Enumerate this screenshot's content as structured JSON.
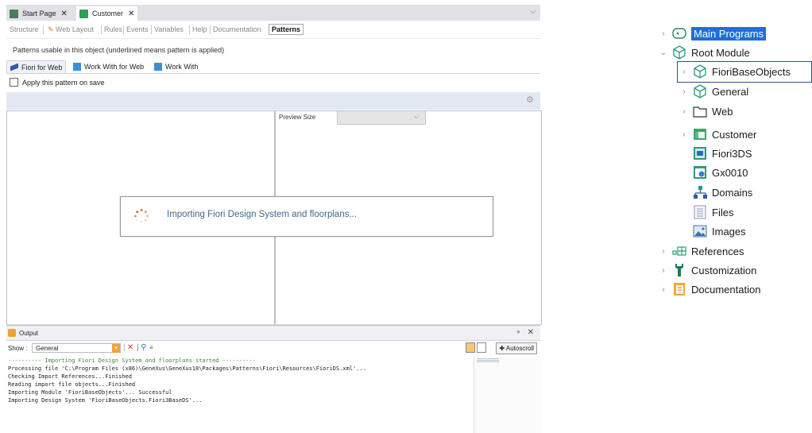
{
  "doc_tabs": [
    {
      "label": "Start Page",
      "close": "✕"
    },
    {
      "label": "Customer",
      "close": "✕"
    }
  ],
  "sub_tabs": [
    "Structure",
    "Web Layout",
    "Rules",
    "Events",
    "Variables",
    "Help",
    "Documentation",
    "Patterns"
  ],
  "info_text": "Patterns usable in this object (underlined means pattern is applied)",
  "pattern_tabs": [
    "Fiori for Web",
    "Work With for Web",
    "Work With"
  ],
  "apply_label": "Apply this pattern on save",
  "preview": {
    "label": "Preview Size",
    "value": ""
  },
  "popup_message": "Importing Fiori Design System and floorplans...",
  "output": {
    "title": "Output",
    "show_label": "Show :",
    "show_value": "General",
    "autoscroll": "Autoscroll",
    "lines": [
      "---------- Importing Fiori Design System and floorplans started ----------",
      "Processing file 'C:\\Program Files (x86)\\GeneXus\\GeneXus18\\Packages\\Patterns\\Fiori\\Resources\\FioriDS.xml'...",
      "Checking Import References...Finished",
      "Reading import file objects...Finished",
      "Importing Module 'FioriBaseObjects'... Successful",
      "Importing Design System 'FioriBaseObjects.Fiori3BaseDS'..."
    ]
  },
  "tree": [
    {
      "label": "Main Programs",
      "icon": "main-programs-icon"
    },
    {
      "label": "Root Module",
      "icon": "module-icon"
    },
    {
      "label": "FioriBaseObjects",
      "icon": "module-icon"
    },
    {
      "label": "General",
      "icon": "module-icon"
    },
    {
      "label": "Web",
      "icon": "folder-icon"
    },
    {
      "label": "Customer",
      "icon": "transaction-icon"
    },
    {
      "label": "Fiori3DS",
      "icon": "design-system-icon"
    },
    {
      "label": "Gx0010",
      "icon": "web-panel-icon"
    },
    {
      "label": "Domains",
      "icon": "domains-icon"
    },
    {
      "label": "Files",
      "icon": "files-icon"
    },
    {
      "label": "Images",
      "icon": "images-icon"
    },
    {
      "label": "References",
      "icon": "references-icon"
    },
    {
      "label": "Customization",
      "icon": "customization-icon"
    },
    {
      "label": "Documentation",
      "icon": "documentation-icon"
    }
  ],
  "colors": {
    "selection": "#1e6fd9",
    "popup_text": "#3e6a8f",
    "highlight_box": "#2d4f8f"
  }
}
